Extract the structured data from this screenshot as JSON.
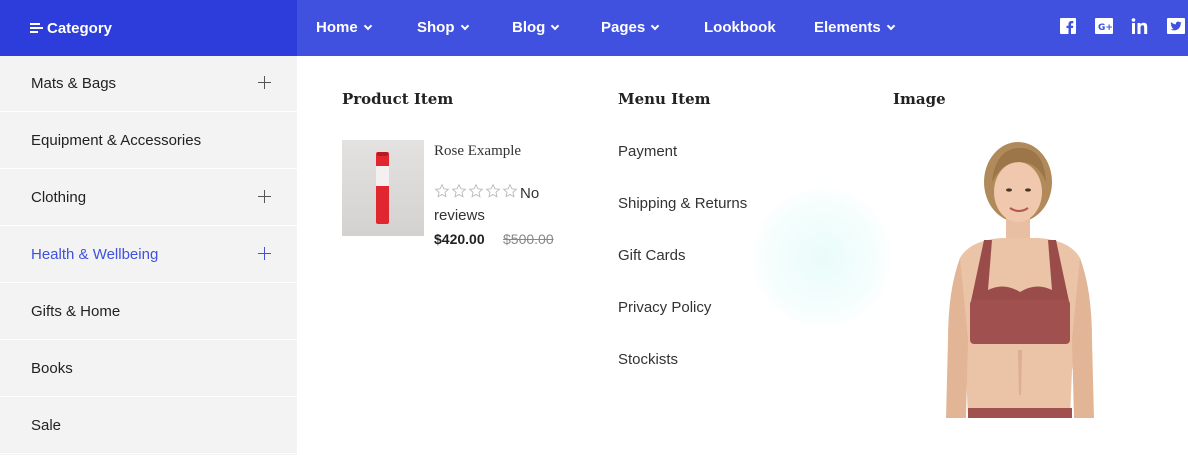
{
  "header": {
    "category_label": "Category",
    "nav": [
      {
        "label": "Home",
        "has_dropdown": true
      },
      {
        "label": "Shop",
        "has_dropdown": true
      },
      {
        "label": "Blog",
        "has_dropdown": true
      },
      {
        "label": "Pages",
        "has_dropdown": true
      },
      {
        "label": "Lookbook",
        "has_dropdown": false
      },
      {
        "label": "Elements",
        "has_dropdown": true
      }
    ],
    "social": [
      "facebook-icon",
      "google-plus-icon",
      "linkedin-icon",
      "twitter-icon"
    ]
  },
  "sidebar": {
    "items": [
      {
        "label": "Mats & Bags",
        "expandable": true
      },
      {
        "label": "Equipment & Accessories",
        "expandable": false
      },
      {
        "label": "Clothing",
        "expandable": true
      },
      {
        "label": "Health & Wellbeing",
        "expandable": true,
        "active": true
      },
      {
        "label": "Gifts & Home",
        "expandable": false
      },
      {
        "label": "Books",
        "expandable": false
      },
      {
        "label": "Sale",
        "expandable": false
      }
    ]
  },
  "mega_menu": {
    "product_column": {
      "title": "Product Item",
      "product": {
        "name": "Rose Example",
        "rating_stars": 0,
        "reviews_text": "No reviews",
        "price": "$420.00",
        "old_price": "$500.00"
      }
    },
    "menu_column": {
      "title": "Menu Item",
      "links": [
        "Payment",
        "Shipping & Returns",
        "Gift Cards",
        "Privacy Policy",
        "Stockists"
      ]
    },
    "image_column": {
      "title": "Image"
    }
  },
  "colors": {
    "brand": "#3f51de",
    "brand_dark": "#2c3ddb",
    "sidebar_bg": "#f3f3f3",
    "active": "#3f51de"
  }
}
